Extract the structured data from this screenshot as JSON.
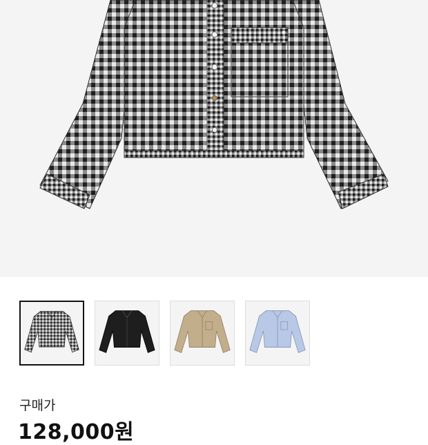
{
  "product": {
    "main_image": "gingham-check-cropped-shirt",
    "selected_color_index": 0,
    "colors": [
      {
        "name": "gingham-check",
        "swatch": "#2b2b2b"
      },
      {
        "name": "black",
        "swatch": "#1e1e1e"
      },
      {
        "name": "beige",
        "swatch": "#c3ae8c"
      },
      {
        "name": "light-blue",
        "swatch": "#b8c8e6"
      }
    ]
  },
  "price": {
    "label": "구매가",
    "value": "128,000원"
  }
}
